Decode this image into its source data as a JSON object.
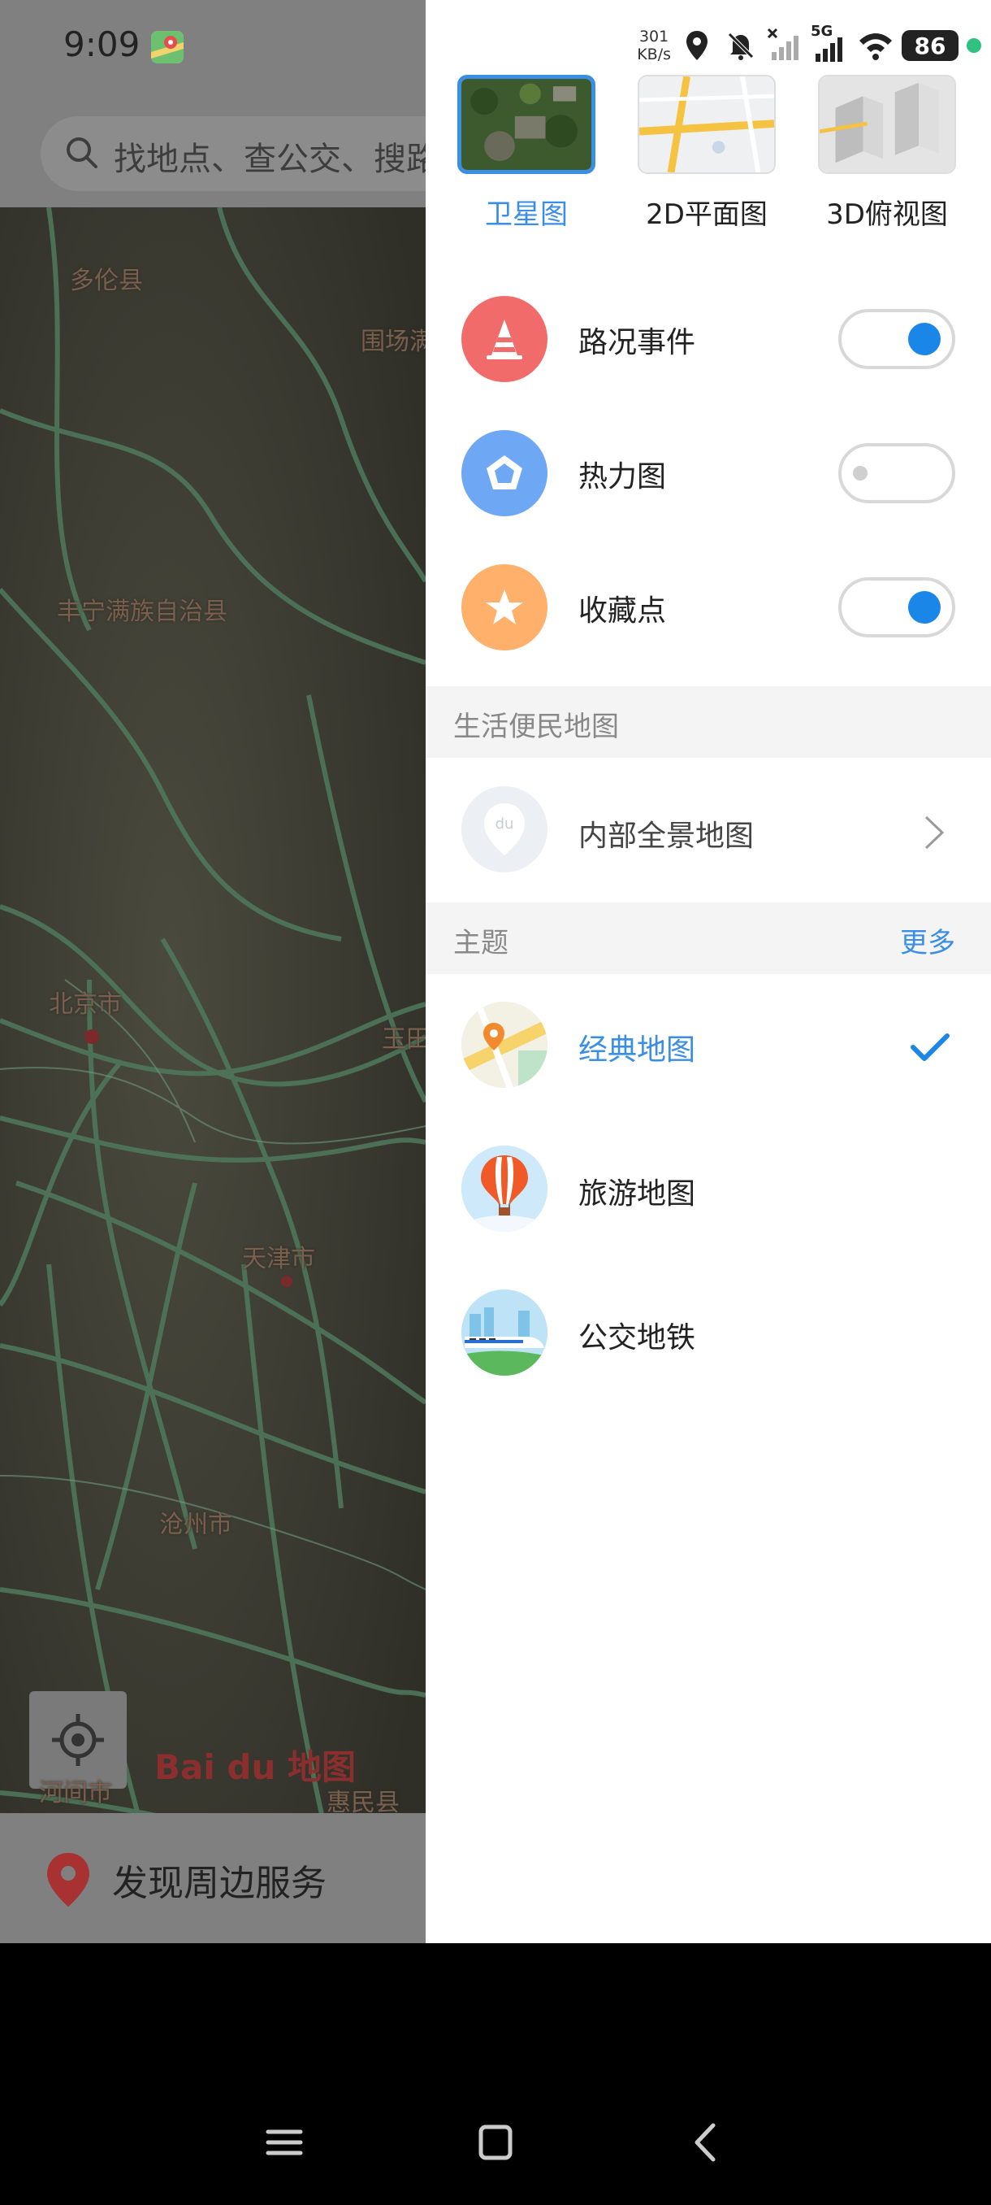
{
  "status_bar": {
    "time": "9:09",
    "net_speed_value": "301",
    "net_speed_unit": "KB/s",
    "network_type": "5G",
    "battery": "86"
  },
  "search": {
    "placeholder": "找地点、查公交、搜路线"
  },
  "map": {
    "labels": [
      "多伦县",
      "围场满族蒙古族自治县",
      "丰宁满族自治县",
      "北京市",
      "天津市",
      "沧州市",
      "惠民县",
      "河间市",
      "玉田"
    ],
    "logo": "Bai du 地图"
  },
  "discover": {
    "label": "发现周边服务"
  },
  "drawer": {
    "map_types": [
      {
        "label": "卫星图",
        "active": true
      },
      {
        "label": "2D平面图",
        "active": false
      },
      {
        "label": "3D俯视图",
        "active": false
      }
    ],
    "layers": [
      {
        "label": "路况事件",
        "enabled": true,
        "icon": "traffic-cone-icon",
        "color": "#f26b6b"
      },
      {
        "label": "热力图",
        "enabled": false,
        "icon": "pentagon-icon",
        "color": "#6ea8f5"
      },
      {
        "label": "收藏点",
        "enabled": true,
        "icon": "star-icon",
        "color": "#ffb06a"
      }
    ],
    "life_section": {
      "title": "生活便民地图",
      "items": [
        {
          "label": "内部全景地图",
          "icon": "du-pin-icon"
        }
      ]
    },
    "theme_section": {
      "title": "主题",
      "more": "更多",
      "items": [
        {
          "label": "经典地图",
          "selected": true,
          "icon": "classic-map-icon"
        },
        {
          "label": "旅游地图",
          "selected": false,
          "icon": "hot-air-balloon-icon"
        },
        {
          "label": "公交地铁",
          "selected": false,
          "icon": "train-icon"
        }
      ]
    }
  },
  "colors": {
    "accent": "#3a8ee6",
    "toggle_on": "#1a86e8"
  }
}
